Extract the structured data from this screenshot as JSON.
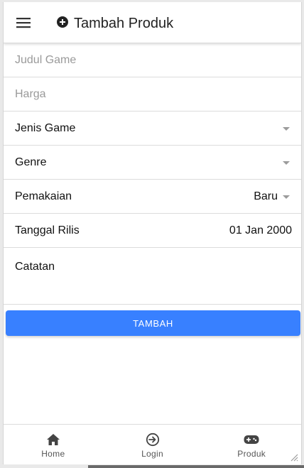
{
  "header": {
    "title": "Tambah Produk",
    "menu_icon": "menu-icon",
    "title_icon": "add-circle-icon"
  },
  "form": {
    "judul_placeholder": "Judul Game",
    "judul_value": "",
    "harga_placeholder": "Harga",
    "harga_value": "",
    "jenis_label": "Jenis Game",
    "jenis_value": "",
    "genre_label": "Genre",
    "genre_value": "",
    "pemakaian_label": "Pemakaian",
    "pemakaian_value": "Baru",
    "tanggal_label": "Tanggal Rilis",
    "tanggal_value": "01 Jan 2000",
    "catatan_label": "Catatan"
  },
  "button": {
    "label": "TAMBAH",
    "color": "#3880ff"
  },
  "tabs": [
    {
      "label": "Home",
      "icon": "home-icon"
    },
    {
      "label": "Login",
      "icon": "login-icon"
    },
    {
      "label": "Produk",
      "icon": "gamepad-icon"
    }
  ]
}
